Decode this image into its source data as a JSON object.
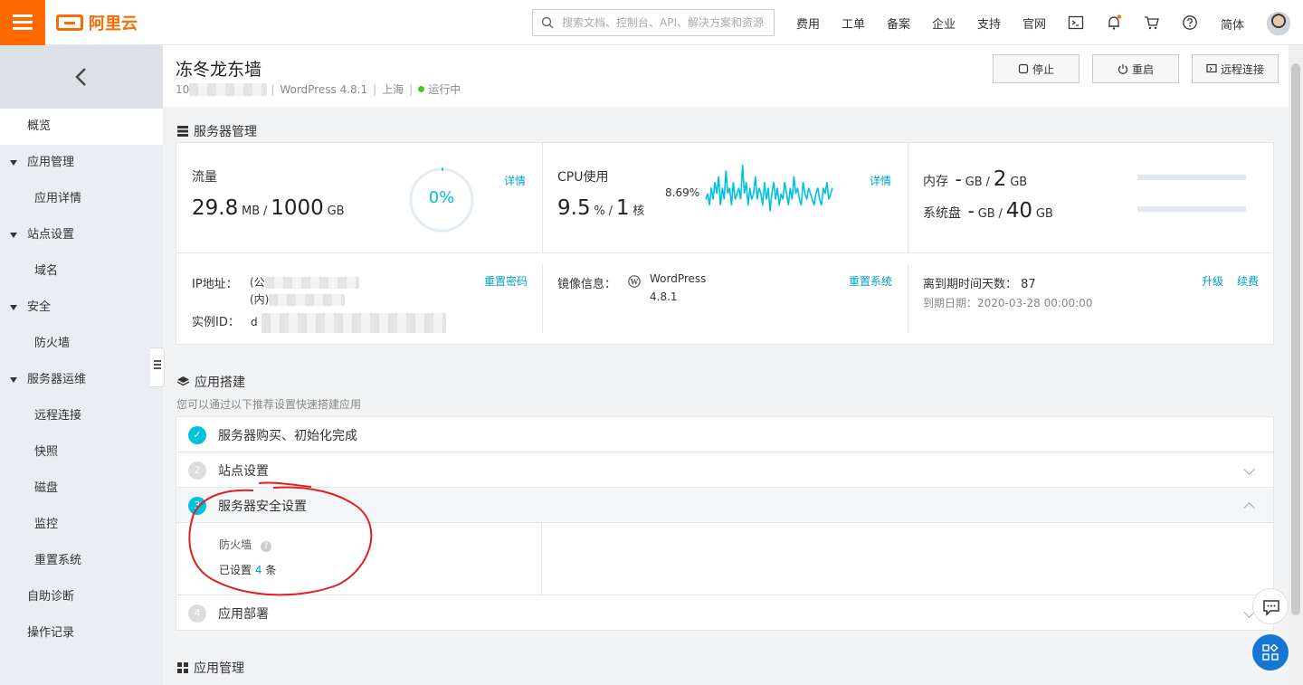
{
  "topbar": {
    "brand": "阿里云",
    "search_placeholder": "搜索文档、控制台、API、解决方案和资源",
    "nav": [
      "费用",
      "工单",
      "备案",
      "企业",
      "支持",
      "官网"
    ],
    "lang": "简体"
  },
  "sidebar": {
    "items": [
      {
        "label": "概览",
        "level": 1,
        "active": true,
        "expandable": false
      },
      {
        "label": "应用管理",
        "level": 1,
        "expandable": true
      },
      {
        "label": "应用详情",
        "level": 2
      },
      {
        "label": "站点设置",
        "level": 1,
        "expandable": true
      },
      {
        "label": "域名",
        "level": 2
      },
      {
        "label": "安全",
        "level": 1,
        "expandable": true
      },
      {
        "label": "防火墙",
        "level": 2
      },
      {
        "label": "服务器运维",
        "level": 1,
        "expandable": true
      },
      {
        "label": "远程连接",
        "level": 2
      },
      {
        "label": "快照",
        "level": 2
      },
      {
        "label": "磁盘",
        "level": 2
      },
      {
        "label": "监控",
        "level": 2
      },
      {
        "label": "重置系统",
        "level": 2
      },
      {
        "label": "自助诊断",
        "level": 1
      },
      {
        "label": "操作记录",
        "level": 1
      }
    ]
  },
  "header": {
    "title": "冻冬龙东墙",
    "ip_prefix": "10",
    "image": "WordPress 4.8.1",
    "region": "上海",
    "status": "运行中",
    "status_color": "#52c41a",
    "buttons": {
      "stop": "停止",
      "restart": "重启",
      "remote": "远程连接"
    }
  },
  "server_mgmt": {
    "section_title": "服务器管理",
    "traffic": {
      "label": "流量",
      "used": "29.8",
      "used_unit": "MB",
      "sep": "/",
      "total": "1000",
      "total_unit": "GB",
      "percent": "0%",
      "detail": "详情"
    },
    "cpu": {
      "label": "CPU使用",
      "value": "9.5",
      "unit": "%",
      "sep": "/",
      "cores": "1",
      "cores_unit": "核",
      "peak": "8.69%",
      "detail": "详情",
      "series": [
        4,
        5,
        3,
        6,
        4,
        7,
        5,
        8,
        3,
        6,
        4,
        9,
        5,
        6,
        3,
        7,
        4,
        5,
        6,
        4,
        10,
        5,
        7,
        3,
        6,
        4,
        5,
        8,
        4,
        6,
        5,
        3,
        7,
        4,
        6,
        2,
        5,
        7,
        4,
        6,
        3,
        5,
        4,
        7,
        5,
        3,
        6,
        4,
        8,
        5,
        6,
        4,
        3,
        7,
        5,
        4,
        6,
        5,
        4,
        3,
        5,
        6,
        4,
        3,
        6,
        5,
        7,
        4,
        5,
        6
      ]
    },
    "memory": {
      "label": "内存",
      "used": "-",
      "used_unit": "GB",
      "sep": "/",
      "total": "2",
      "total_unit": "GB"
    },
    "disk": {
      "label": "系统盘",
      "used": "-",
      "used_unit": "GB",
      "sep": "/",
      "total": "40",
      "total_unit": "GB"
    },
    "ip": {
      "label": "IP地址：",
      "public_prefix": "(公",
      "private_prefix": "(内)",
      "reset": "重置密码"
    },
    "instance": {
      "label": "实例ID：",
      "prefix": "d"
    },
    "image": {
      "label": "镜像信息：",
      "name": "WordPress",
      "version": "4.8.1",
      "reset": "重置系统"
    },
    "expire": {
      "label": "离到期时间天数：",
      "days": "87",
      "date_label": "到期日期：",
      "date": "2020-03-28 00:00:00",
      "upgrade": "升级",
      "renew": "续费"
    }
  },
  "app_setup": {
    "section_title": "应用搭建",
    "desc": "您可以通过以下推荐设置快速搭建应用",
    "steps": [
      {
        "num": "✓",
        "label": "服务器购买、初始化完成",
        "done": true
      },
      {
        "num": "2",
        "label": "站点设置"
      },
      {
        "num": "3",
        "label": "服务器安全设置",
        "expanded": true
      },
      {
        "num": "4",
        "label": "应用部署"
      }
    ],
    "firewall": {
      "label": "防火墙",
      "text": "已设置",
      "count": "4",
      "suffix": "条"
    }
  },
  "app_mgmt": {
    "section_title": "应用管理"
  },
  "accent_color": "#00a2ca",
  "brand_color": "#ff6a00"
}
